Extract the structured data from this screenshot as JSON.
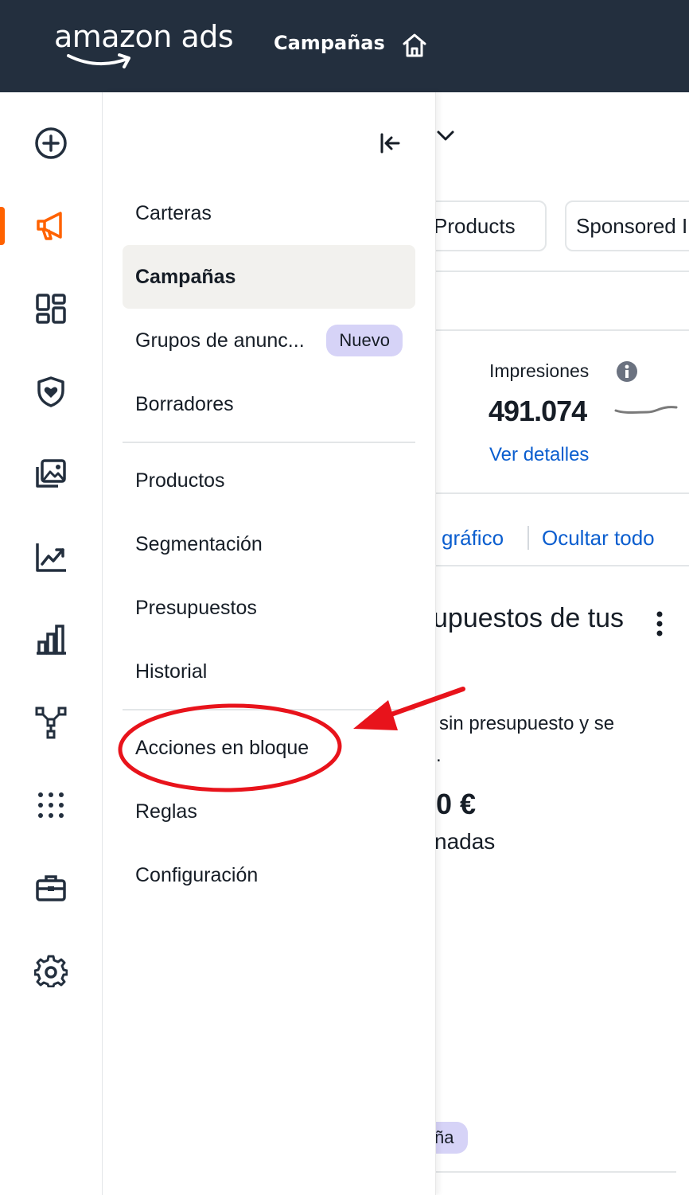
{
  "header": {
    "logo_text": "amazon ads",
    "title": "Campañas",
    "home_icon": "home-icon"
  },
  "rail": {
    "items": [
      {
        "icon": "plus-circle-icon"
      },
      {
        "icon": "megaphone-icon",
        "active": true
      },
      {
        "icon": "dashboard-icon"
      },
      {
        "icon": "shield-heart-icon"
      },
      {
        "icon": "images-icon"
      },
      {
        "icon": "trend-chart-icon"
      },
      {
        "icon": "bar-chart-icon"
      },
      {
        "icon": "network-icon"
      },
      {
        "icon": "grid-dots-icon"
      },
      {
        "icon": "briefcase-icon"
      },
      {
        "icon": "settings-gear-icon"
      }
    ],
    "active_color": "#ff6200"
  },
  "menu": {
    "items": [
      {
        "label": "Carteras"
      },
      {
        "label": "Campañas",
        "active": true
      },
      {
        "label": "Grupos de anunc...",
        "badge": "Nuevo"
      },
      {
        "label": "Borradores"
      },
      {
        "label": "Productos"
      },
      {
        "label": "Segmentación"
      },
      {
        "label": "Presupuestos"
      },
      {
        "label": "Historial"
      },
      {
        "label": "Acciones en bloque",
        "highlighted": true
      },
      {
        "label": "Reglas"
      },
      {
        "label": "Configuración"
      }
    ]
  },
  "background": {
    "tab1": "l Products",
    "tab2": "Sponsored I",
    "metric_label": "Impresiones",
    "metric_value": "491.074",
    "details_link": "Ver detalles",
    "chart_link": "l gráfico",
    "hide_all_link": "Ocultar todo",
    "section_title": "upuestos de tus",
    "text_line1": "sin presupuesto y se",
    "text_line2": ".",
    "amount": "0 €",
    "text_line3": "nadas",
    "tag": "ña"
  },
  "colors": {
    "topbar": "#232f3e",
    "link": "#0b5ecf",
    "annotation": "#e8131b",
    "badge": "#d6d3f7"
  }
}
